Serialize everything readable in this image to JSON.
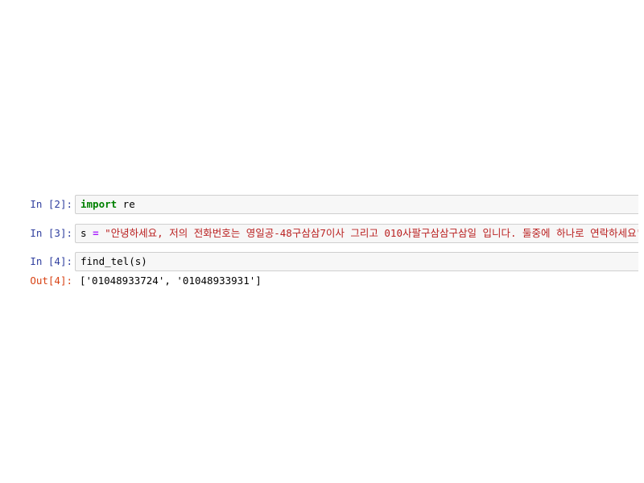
{
  "cells": [
    {
      "in_prompt": "In [2]:",
      "code": {
        "keyword": "import",
        "rest": " re"
      }
    },
    {
      "in_prompt": "In [3]:",
      "code": {
        "var": "s",
        "op": "=",
        "string": "\"안녕하세요, 저의 전화번호는 영일공-48구삼삼7이사 그리고 010사팔구삼삼구삼일 입니다. 둘중에 하나로 연락하세요\""
      }
    },
    {
      "in_prompt": "In [4]:",
      "code": {
        "func": "find_tel",
        "open": "(",
        "arg": "s",
        "close": ")"
      },
      "out_prompt": "Out[4]:",
      "output": "['01048933724', '01048933931']"
    }
  ],
  "colors": {
    "in_prompt": "#303f9f",
    "out_prompt": "#d84315",
    "keyword": "#008000",
    "operator": "#aa22ff",
    "string": "#ba2121",
    "input_bg": "#f7f7f7",
    "input_border": "#cfcfcf"
  }
}
